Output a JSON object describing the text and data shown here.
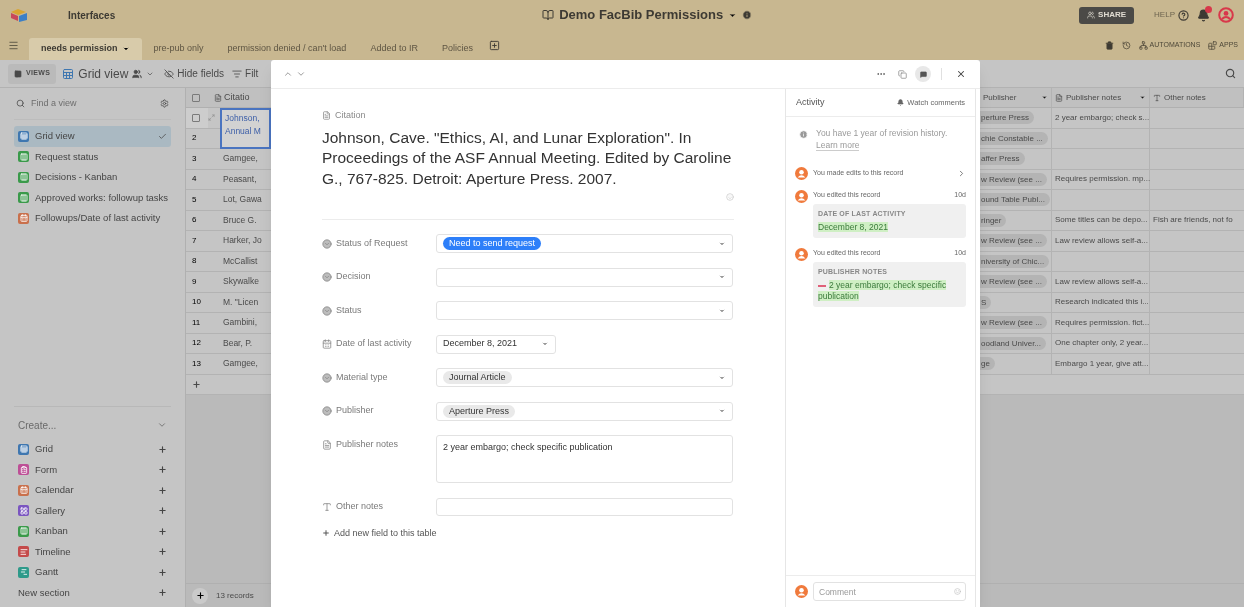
{
  "app": {
    "name": "Interfaces",
    "base": "Demo FacBib Permissions",
    "share": "SHARE",
    "help": "HELP",
    "extensions": [
      "AUTOMATIONS",
      "APPS"
    ]
  },
  "tables": [
    {
      "label": "needs permission",
      "selected": true
    },
    {
      "label": "pre-pub only",
      "selected": false
    },
    {
      "label": "permission denied / can't load",
      "selected": false
    },
    {
      "label": "Added to IR",
      "selected": false
    },
    {
      "label": "Policies",
      "selected": false
    }
  ],
  "toolbar": {
    "views": "VIEWS",
    "view": "Grid view",
    "hide_fields": "Hide fields",
    "filter": "Filt"
  },
  "sidebar": {
    "search_placeholder": "Find a view",
    "views": [
      {
        "label": "Grid view",
        "kind": "grid",
        "selected": true
      },
      {
        "label": "Request status",
        "kind": "kanban",
        "selected": false
      },
      {
        "label": "Decisions - Kanban",
        "kind": "kanban",
        "selected": false
      },
      {
        "label": "Approved works: followup tasks",
        "kind": "kanban",
        "selected": false
      },
      {
        "label": "Followups/Date of last activity",
        "kind": "calendar",
        "selected": false
      }
    ],
    "create_title": "Create...",
    "create_items": [
      {
        "label": "Grid",
        "kind": "grid"
      },
      {
        "label": "Form",
        "kind": "form"
      },
      {
        "label": "Calendar",
        "kind": "calendar"
      },
      {
        "label": "Gallery",
        "kind": "gallery"
      },
      {
        "label": "Kanban",
        "kind": "kanban"
      },
      {
        "label": "Timeline",
        "kind": "timeline"
      },
      {
        "label": "Gantt",
        "kind": "gantt"
      }
    ],
    "new_section": "New section"
  },
  "grid_left": {
    "header": "Citatio",
    "all_checked": false,
    "record_count": "13 records",
    "rows": [
      {
        "citation": "Johnson, Annual M",
        "selected": true,
        "checked": false
      },
      {
        "number": "2",
        "selected": false
      },
      {
        "number": "3",
        "citation": "Gamgee,",
        "selected": false
      },
      {
        "number": "4",
        "citation": "Peasant,",
        "selected": false
      },
      {
        "number": "5",
        "citation": "Lot, Gawa",
        "selected": false
      },
      {
        "number": "6",
        "citation": "Bruce G.",
        "selected": false
      },
      {
        "number": "7",
        "citation": "Harker, Jo",
        "selected": false
      },
      {
        "number": "8",
        "citation": "McCallist",
        "selected": false
      },
      {
        "number": "9",
        "citation": "Skywalke",
        "selected": false
      },
      {
        "number": "10",
        "citation": "M. \"Licen",
        "selected": false
      },
      {
        "number": "11",
        "citation": "Gambini,",
        "selected": false
      },
      {
        "number": "12",
        "citation": "Bear, P.",
        "selected": false
      },
      {
        "number": "13",
        "citation": "Gamgee,",
        "selected": false
      }
    ]
  },
  "grid_right": {
    "columns": [
      {
        "label": "Publisher",
        "kind": "none",
        "dropdown": true
      },
      {
        "label": "Publisher notes",
        "kind": "longtext",
        "dropdown": true
      },
      {
        "label": "Other notes",
        "kind": "text",
        "dropdown": false
      }
    ],
    "rows": [
      {
        "publisher": "perture Press",
        "notes": "2 year embargo; check s..."
      },
      {
        "publisher": "chie Constable ..."
      },
      {
        "publisher": "affer Press"
      },
      {
        "publisher": "w Review (see ...",
        "notes": "Requires permission. mp..."
      },
      {
        "publisher": "ound Table Publ..."
      },
      {
        "publisher": "ringer",
        "notes": "Some titles can be depo...",
        "other": "Fish are friends, not fo"
      },
      {
        "publisher": "w Review (see ...",
        "notes": "Law review allows self-a..."
      },
      {
        "publisher": "niversity of Chic..."
      },
      {
        "publisher": "w Review (see ...",
        "notes": "Law review allows self-a..."
      },
      {
        "publisher": "S",
        "notes": "Research indicated this i..."
      },
      {
        "publisher": "w Review (see ...",
        "notes": "Requires permission. fict..."
      },
      {
        "publisher": "oodland Univer...",
        "notes": "One chapter only, 2 year..."
      },
      {
        "publisher": "ge",
        "notes": "Embargo 1 year, give att..."
      }
    ]
  },
  "record": {
    "primary_label": "Citation",
    "primary_value": "Johnson, Cave. \"Ethics, AI, and Lunar Exploration\". In Proceedings of the ASF Annual Meeting. Edited by Caroline G., 767-825. Detroit: Aperture Press. 2007.",
    "fields": [
      {
        "label": "Status of Request",
        "kind": "select",
        "value": "Need to send request",
        "color": "#2d7ff9"
      },
      {
        "label": "Decision",
        "kind": "select"
      },
      {
        "label": "Status",
        "kind": "select"
      },
      {
        "label": "Date of last activity",
        "kind": "date",
        "value": "December 8, 2021"
      },
      {
        "label": "Material type",
        "kind": "select",
        "value": "Journal Article",
        "color": "#e9e9e9"
      },
      {
        "label": "Publisher",
        "kind": "select",
        "value": "Aperture Press",
        "color": "#e9e9e9"
      },
      {
        "label": "Publisher notes",
        "kind": "longtext",
        "value": "2 year embargo; check specific publication"
      },
      {
        "label": "Other notes",
        "kind": "text"
      }
    ],
    "add_field": "Add new field to this table"
  },
  "activity": {
    "title": "Activity",
    "watch": "Watch comments",
    "notice": "You have 1 year of revision history.",
    "learn_more": "Learn more",
    "events": [
      {
        "kind": "summary",
        "text": "You made edits to this record"
      },
      {
        "kind": "edit",
        "text": "You edited this record",
        "time": "10d",
        "field": "DATE OF LAST ACTIVITY",
        "value": "December 8, 2021",
        "removed": false
      },
      {
        "kind": "edit",
        "text": "You edited this record",
        "time": "10d",
        "field": "PUBLISHER NOTES",
        "value": "2 year embargo; check specific publication",
        "removed": true
      }
    ],
    "comment_placeholder": "Comment"
  }
}
